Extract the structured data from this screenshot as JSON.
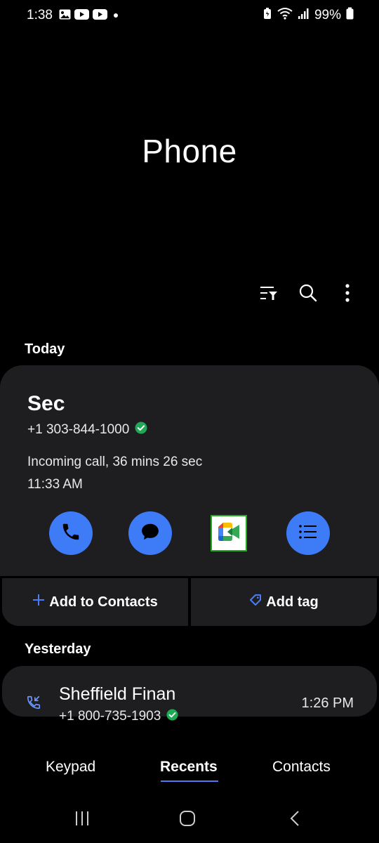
{
  "status_bar": {
    "time": "1:38",
    "battery": "99%",
    "left_icons": [
      "image-icon",
      "youtube-icon",
      "youtube-icon",
      "dot-icon"
    ],
    "right_icons": [
      "battery-saver-icon",
      "wifi-icon",
      "signal-icon",
      "battery-icon"
    ]
  },
  "header": {
    "title": "Phone"
  },
  "toolbar": {
    "icons": [
      "filter-icon",
      "search-icon",
      "more-options-icon"
    ]
  },
  "sections": {
    "today": "Today",
    "yesterday": "Yesterday"
  },
  "expanded_call": {
    "name": "Sec",
    "number": "+1 303-844-1000",
    "detail": "Incoming call, 36 mins 26 sec",
    "time": "11:33 AM",
    "actions": [
      "phone-icon",
      "message-icon",
      "google-meet-icon",
      "details-icon"
    ],
    "add_to_contacts": "Add to Contacts",
    "add_tag": "Add tag"
  },
  "recent_calls": [
    {
      "name": "Sheffield Finan",
      "number": "+1 800-735-1903",
      "time": "1:26 PM",
      "icon": "incoming-call-icon"
    }
  ],
  "tabs": [
    {
      "label": "Keypad",
      "active": false
    },
    {
      "label": "Recents",
      "active": true
    },
    {
      "label": "Contacts",
      "active": false
    }
  ],
  "nav": [
    "recent-apps-icon",
    "home-icon",
    "back-icon"
  ],
  "colors": {
    "accent": "#3e7bf7",
    "card": "#1e1e20",
    "verified": "#1fa855",
    "background": "#000000"
  }
}
